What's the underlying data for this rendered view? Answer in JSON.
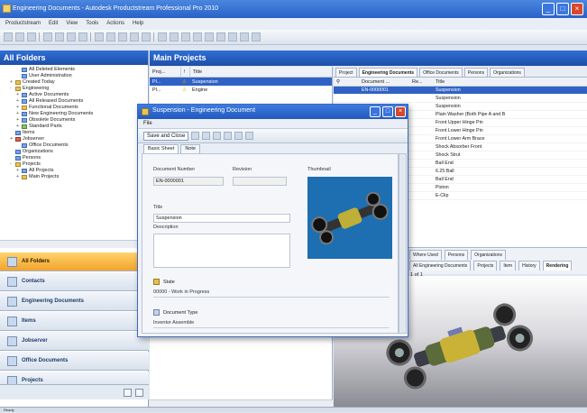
{
  "window": {
    "title": "Engineering Documents - Autodesk Productstream Professional Pro 2010"
  },
  "menu": [
    "Productstream",
    "Edit",
    "View",
    "Tools",
    "Actions",
    "Help"
  ],
  "left_pane": {
    "header": "All Folders",
    "tree": [
      {
        "label": "All Deleted Elements",
        "indent": 2,
        "icon": "b"
      },
      {
        "label": "User Administration",
        "indent": 2,
        "icon": "b"
      },
      {
        "label": "Created Today",
        "indent": 1,
        "icon": "y",
        "exp": "+"
      },
      {
        "label": "Engineering",
        "indent": 1,
        "icon": "y",
        "exp": "-"
      },
      {
        "label": "Active Documents",
        "indent": 2,
        "icon": "b",
        "exp": "+"
      },
      {
        "label": "All Released Documents",
        "indent": 2,
        "icon": "b",
        "exp": "+"
      },
      {
        "label": "Functional Documents",
        "indent": 2,
        "icon": "y",
        "exp": "+"
      },
      {
        "label": "New Engineering Documents",
        "indent": 2,
        "icon": "b",
        "exp": "+"
      },
      {
        "label": "Obsolete Documents",
        "indent": 2,
        "icon": "b",
        "exp": "+"
      },
      {
        "label": "Standard Parts",
        "indent": 2,
        "icon": "g",
        "exp": "+"
      },
      {
        "label": "Items",
        "indent": 1,
        "icon": "b"
      },
      {
        "label": "Jobserver",
        "indent": 1,
        "icon": "r",
        "exp": "+"
      },
      {
        "label": "Office Documents",
        "indent": 2,
        "icon": "b"
      },
      {
        "label": "Organizations",
        "indent": 1,
        "icon": "b"
      },
      {
        "label": "Persons",
        "indent": 1,
        "icon": "b"
      },
      {
        "label": "Projects",
        "indent": 1,
        "icon": "y",
        "exp": "-"
      },
      {
        "label": "All Projects",
        "indent": 2,
        "icon": "b",
        "exp": "+"
      },
      {
        "label": "Main Projects",
        "indent": 2,
        "icon": "y",
        "exp": "+"
      }
    ],
    "nav": [
      {
        "label": "All Folders",
        "active": true
      },
      {
        "label": "Contacts"
      },
      {
        "label": "Engineering Documents"
      },
      {
        "label": "Items"
      },
      {
        "label": "Jobserver"
      },
      {
        "label": "Office Documents"
      },
      {
        "label": "Projects"
      }
    ]
  },
  "main": {
    "header": "Main Projects",
    "mid_columns": [
      "Proj...",
      "!",
      "Title"
    ],
    "mid_rows": [
      {
        "c1": "Pl...",
        "c3": "Suspension",
        "sel": true
      },
      {
        "c1": "Pl...",
        "c3": "Engine",
        "sel": false
      }
    ],
    "right_col_header": "Project",
    "right_tabs": [
      "Engineering Documents",
      "Office Documents",
      "Persons",
      "Organizations"
    ],
    "grid_columns": [
      "Document ...",
      "Re...",
      "Title"
    ],
    "grid_rows": [
      {
        "doc": "EN-0000001",
        "title": "Suspension",
        "sel": true
      },
      {
        "doc": "",
        "title": "Suspension"
      },
      {
        "doc": "",
        "title": "Suspension"
      },
      {
        "doc": "",
        "title": "Plain Washer (Both Pipe A and B"
      },
      {
        "doc": "",
        "title": "Front Upper Hinge Pin"
      },
      {
        "doc": "",
        "title": "Front Lower Hinge Pin"
      },
      {
        "doc": "",
        "title": "Front Lower Arm Brace"
      },
      {
        "doc": "",
        "title": "Shock Absorber Front"
      },
      {
        "doc": "",
        "title": "Shock Strut"
      },
      {
        "doc": "",
        "title": "Ball End"
      },
      {
        "doc": "",
        "title": "6.25 Ball"
      },
      {
        "doc": "",
        "title": "Ball End"
      },
      {
        "doc": "",
        "title": "Piston"
      },
      {
        "doc": "",
        "title": "E-Clip"
      }
    ],
    "bottom_tabs": [
      "Where Used",
      "Persons",
      "Organizations"
    ],
    "bottom_tabs2": [
      "All Engineering Documents",
      "Projects",
      "Item",
      "History",
      "Rendering"
    ],
    "pager": "1 of 1"
  },
  "dialog": {
    "title": "Suspension - Engineering Document",
    "menu": "File",
    "save_close": "Save and Close",
    "tabs": [
      "Basic Sheet",
      "Note"
    ],
    "doc_number_label": "Document Number",
    "revision_label": "Revision",
    "thumbnail_label": "Thumbnail",
    "doc_number": "EN-0000001",
    "title_label": "Title",
    "title_value": "Suspension",
    "description_label": "Description",
    "state_label": "State",
    "state_value": "00000 - Work in Progress",
    "doctype_label": "Document Type",
    "doctype_value": "Inventor Assemble"
  },
  "status": {
    "text": "Ready"
  }
}
